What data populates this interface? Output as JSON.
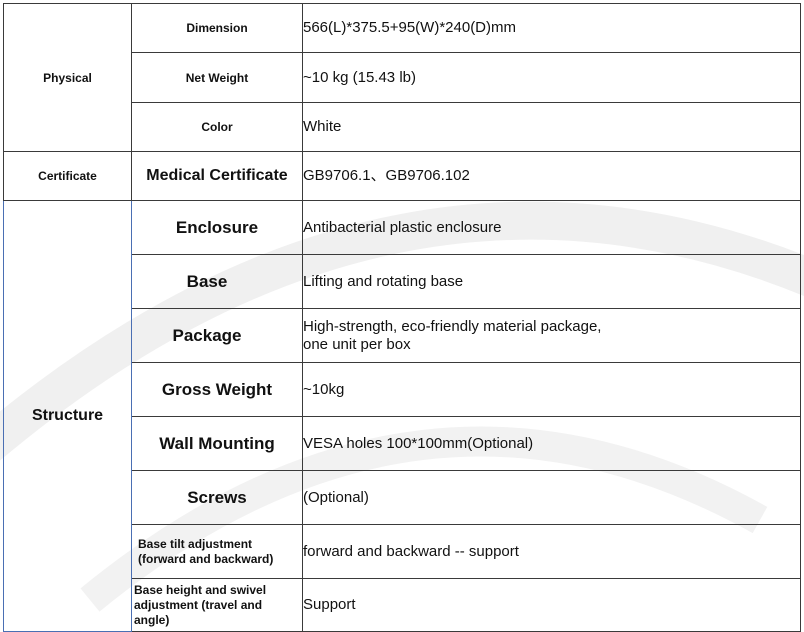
{
  "sections": [
    {
      "name": "Physical",
      "rows": [
        {
          "label": "Dimension",
          "value": "566(L)*375.5+95(W)*240(D)mm"
        },
        {
          "label": "Net Weight",
          "value": "~10 kg (15.43 lb)"
        },
        {
          "label": "Color",
          "value": "White"
        }
      ]
    },
    {
      "name": "Certificate",
      "rows": [
        {
          "label": "Medical Certificate",
          "value": "GB9706.1、GB9706.102"
        }
      ]
    },
    {
      "name": "Structure",
      "rows": [
        {
          "label": "Enclosure",
          "value": "Antibacterial plastic enclosure"
        },
        {
          "label": "Base",
          "value": "Lifting and rotating base"
        },
        {
          "label": "Package",
          "value_line1": "High-strength, eco-friendly material package,",
          "value_line2": "one unit per box"
        },
        {
          "label": "Gross Weight",
          "value": "~10kg"
        },
        {
          "label": "Wall Mounting",
          "value": "VESA holes 100*100mm(Optional)"
        },
        {
          "label": "Screws",
          "value": "(Optional)"
        },
        {
          "label_line1": "Base tilt adjustment",
          "label_line2": "(forward and backward)",
          "value": "forward and backward -- support"
        },
        {
          "label_line1": "Base height and swivel",
          "label_line2": "adjustment (travel and",
          "label_line3": "angle)",
          "value": "Support"
        }
      ]
    }
  ]
}
